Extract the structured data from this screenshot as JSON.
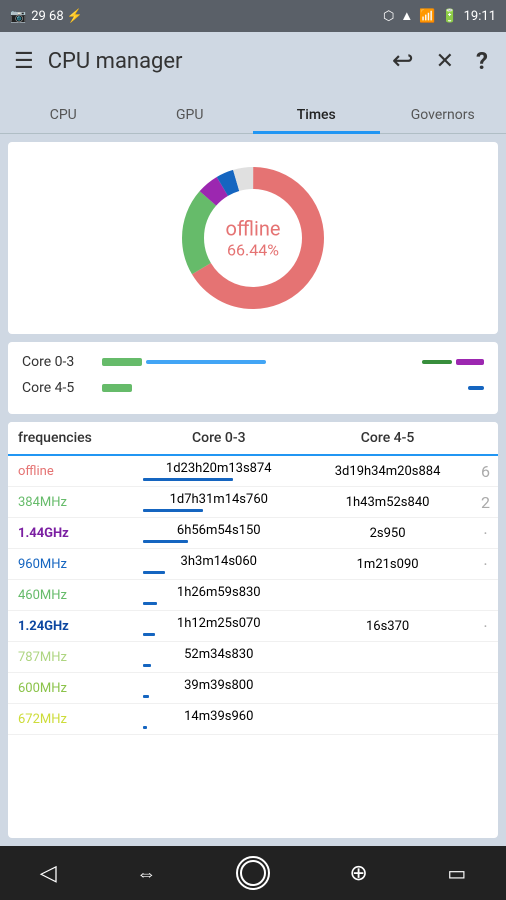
{
  "statusBar": {
    "leftIcons": [
      "📷",
      "29",
      "68",
      "⚡"
    ],
    "rightIcons": [
      "bluetooth",
      "wifi",
      "signal",
      "battery"
    ],
    "time": "19:11"
  },
  "toolbar": {
    "menuIcon": "☰",
    "title": "CPU manager",
    "backIcon": "↩",
    "closeIcon": "✕",
    "helpIcon": "?"
  },
  "tabs": [
    {
      "id": "cpu",
      "label": "CPU",
      "active": false
    },
    {
      "id": "gpu",
      "label": "GPU",
      "active": false
    },
    {
      "id": "times",
      "label": "Times",
      "active": true
    },
    {
      "id": "governors",
      "label": "Governors",
      "active": false
    }
  ],
  "donut": {
    "label": "offline",
    "percent": "66.44%",
    "segments": [
      {
        "color": "#e57373",
        "value": 66.44
      },
      {
        "color": "#66bb6a",
        "value": 20
      },
      {
        "color": "#9c27b0",
        "value": 5
      },
      {
        "color": "#1565c0",
        "value": 4
      },
      {
        "color": "#e0e0e0",
        "value": 4.56
      }
    ]
  },
  "coreRows": [
    {
      "label": "Core 0-3",
      "greenWidth": 40
    },
    {
      "label": "Core 4-5",
      "greenWidth": 30
    }
  ],
  "freqTable": {
    "headers": [
      "frequencies",
      "Core 0-3",
      "Core 4-5"
    ],
    "rows": [
      {
        "freq": "offline",
        "colorClass": "offline-color",
        "core03": "1d23h20m13s874",
        "core45": "3d19h34m20s884",
        "extra": "6",
        "bar03width": 90,
        "bar45width": 85
      },
      {
        "freq": "384MHz",
        "colorClass": "green-color",
        "core03": "1d7h31m14s760",
        "core45": "1h43m52s840",
        "extra": "2",
        "bar03width": 60,
        "bar45width": 30
      },
      {
        "freq": "1.44GHz",
        "colorClass": "bold-purple",
        "core03": "6h56m54s150",
        "core45": "2s950",
        "extra": "·",
        "bar03width": 45,
        "bar45width": 8
      },
      {
        "freq": "960MHz",
        "colorClass": "blue-color",
        "core03": "3h3m14s060",
        "core45": "1m21s090",
        "extra": "·",
        "bar03width": 22,
        "bar45width": 12
      },
      {
        "freq": "460MHz",
        "colorClass": "green-color",
        "core03": "1h26m59s830",
        "core45": "",
        "extra": "",
        "bar03width": 14,
        "bar45width": 0
      },
      {
        "freq": "1.24GHz",
        "colorClass": "dark-blue",
        "core03": "1h12m25s070",
        "core45": "16s370",
        "extra": "·",
        "bar03width": 12,
        "bar45width": 6
      },
      {
        "freq": "787MHz",
        "colorClass": "light-green-color",
        "core03": "52m34s830",
        "core45": "",
        "extra": "",
        "bar03width": 8,
        "bar45width": 0
      },
      {
        "freq": "600MHz",
        "colorClass": "olive-color",
        "core03": "39m39s800",
        "core45": "",
        "extra": "",
        "bar03width": 6,
        "bar45width": 0
      },
      {
        "freq": "672MHz",
        "colorClass": "yellow-green",
        "core03": "14m39s960",
        "core45": "",
        "extra": "",
        "bar03width": 4,
        "bar45width": 0
      }
    ]
  },
  "navBar": {
    "icons": [
      "◁",
      "⇔",
      "○",
      "⊕",
      "▭"
    ]
  }
}
